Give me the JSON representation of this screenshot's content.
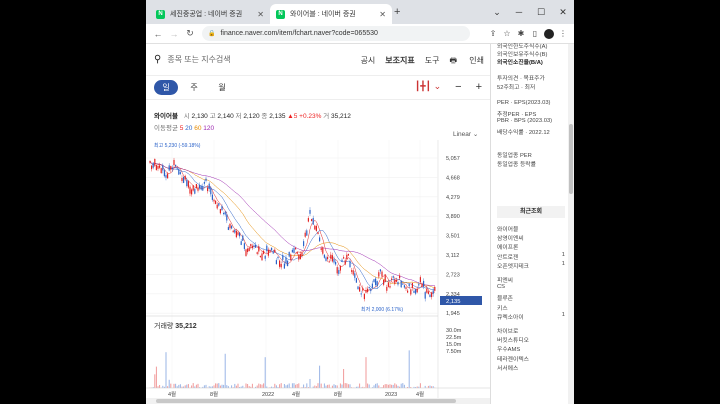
{
  "browser": {
    "tabs": [
      {
        "title": "세진중공업 : 네이버 증권",
        "active": false
      },
      {
        "title": "와이어블 : 네이버 증권",
        "active": true
      }
    ],
    "url": "finance.naver.com/item/fchart.naver?code=065530"
  },
  "search": {
    "placeholder": "종목 또는 지수검색"
  },
  "top_menu": [
    "공시",
    "보조지표",
    "도구",
    "인쇄"
  ],
  "periods": [
    "일",
    "주",
    "월"
  ],
  "active_period": "일",
  "stock": {
    "name": "와이어블",
    "open_label": "시",
    "open": "2,130",
    "high_label": "고",
    "high": "2,140",
    "low_label": "저",
    "low": "2,120",
    "close_label": "종",
    "close": "2,135",
    "change": "▲5",
    "change_pct": "+0.23%",
    "volume_label": "거",
    "volume": "35,212"
  },
  "moving_average": {
    "label": "이동평균",
    "periods": [
      "5",
      "20",
      "60",
      "120"
    ]
  },
  "scale_label": "Linear",
  "price_axis": [
    "5,057",
    "4,668",
    "4,279",
    "3,890",
    "3,501",
    "3,112",
    "2,723",
    "2,334",
    "1,945"
  ],
  "current_price_tag": "2,135",
  "high_marker": "최고 5,230 (-59.18%)",
  "low_marker": "최저 2,000 (6.17%)",
  "volume_panel": {
    "label": "거래량",
    "value": "35,212",
    "axis": [
      "30.0m",
      "22.5m",
      "15.0m",
      "7.50m"
    ]
  },
  "x_axis": [
    "4월",
    "8월",
    "2022",
    "4월",
    "8월",
    "2023",
    "4월"
  ],
  "sidebar": {
    "info_lines": [
      "외국인한도주식수(A)",
      "외국인보유주식수(B)",
      "외국인소진율(B/A)",
      "투자의견 · 목표주가",
      "52주최고 · 최저",
      "PER · EPS(2023.03)",
      "추정PER · EPS",
      "PBR · BPS (2023.03)",
      "배당수익률 · 2022.12",
      "동일업종 PER",
      "동일업종 등락률"
    ],
    "recent_title": "최근조회",
    "recent": [
      {
        "name": "와이어블",
        "count": ""
      },
      {
        "name": "삼영이엔씨",
        "count": ""
      },
      {
        "name": "에이프론",
        "count": ""
      },
      {
        "name": "안트로젠",
        "count": "1"
      },
      {
        "name": "오픈엣지테크",
        "count": "1"
      },
      {
        "name": "피엔씨",
        "count": ""
      },
      {
        "name": "CS",
        "count": ""
      },
      {
        "name": "블루존",
        "count": ""
      },
      {
        "name": "키스",
        "count": ""
      },
      {
        "name": "큐렉소아이",
        "count": "1"
      },
      {
        "name": "차이브로",
        "count": ""
      },
      {
        "name": "버킷스튜디오",
        "count": ""
      },
      {
        "name": "우수AMS",
        "count": ""
      },
      {
        "name": "테라젠이텍스",
        "count": ""
      },
      {
        "name": "서서에스",
        "count": ""
      }
    ]
  },
  "colors": {
    "up": "#e22222",
    "down": "#2a62c9",
    "ma5": "#e22222",
    "ma20": "#2a62c9",
    "ma60": "#e58a00",
    "ma120": "#9c27b0",
    "accent": "#2f57a8"
  }
}
